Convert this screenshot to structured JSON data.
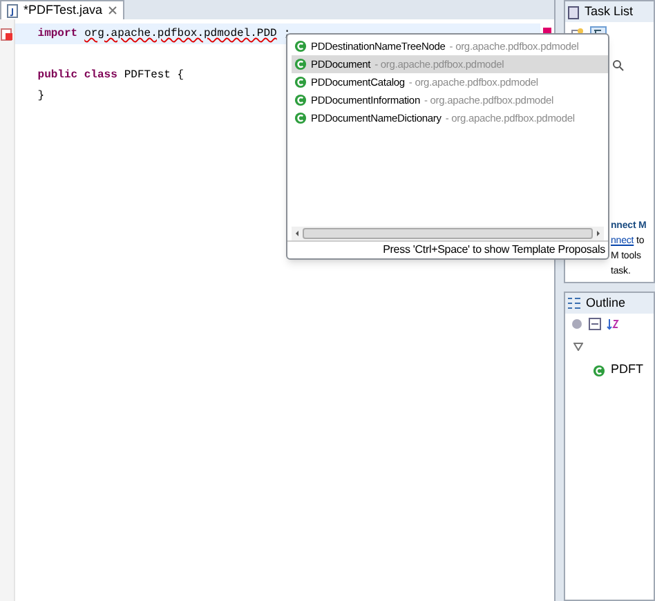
{
  "editor_tab": {
    "title": "*PDFTest.java"
  },
  "code_lines": [
    {
      "kind": "import",
      "keyword": "import",
      "error_text": "org.apache.pdfbox.pdmodel.PDD",
      "text": ";"
    },
    {
      "kind": "class",
      "keyword": "public class",
      "text": "PDFTest {"
    },
    {
      "kind": "plain",
      "text": "}"
    }
  ],
  "proposals": [
    {
      "name": "PDDestinationNameTreeNode",
      "package": "- org.apache.pdfbox.pdmodel",
      "selected": false
    },
    {
      "name": "PDDocument",
      "package": "- org.apache.pdfbox.pdmodel",
      "selected": true
    },
    {
      "name": "PDDocumentCatalog",
      "package": "- org.apache.pdfbox.pdmodel",
      "selected": false
    },
    {
      "name": "PDDocumentInformation",
      "package": "- org.apache.pdfbox.pdmodel",
      "selected": false
    },
    {
      "name": "PDDocumentNameDictionary",
      "package": "- org.apache.pdfbox.pdmodel",
      "selected": false
    }
  ],
  "proposal_hint": "Press 'Ctrl+Space' to show Template Proposals",
  "task_list": {
    "title": "Task List"
  },
  "connect": {
    "heading": "nnect M",
    "link": "nnect",
    "link_suffix": " to",
    "line_2": "M tools",
    "line_3": "task."
  },
  "outline": {
    "title": "Outline",
    "tree": [
      {
        "expanded": true,
        "children": [
          {
            "label": "PDFT"
          }
        ]
      }
    ]
  }
}
